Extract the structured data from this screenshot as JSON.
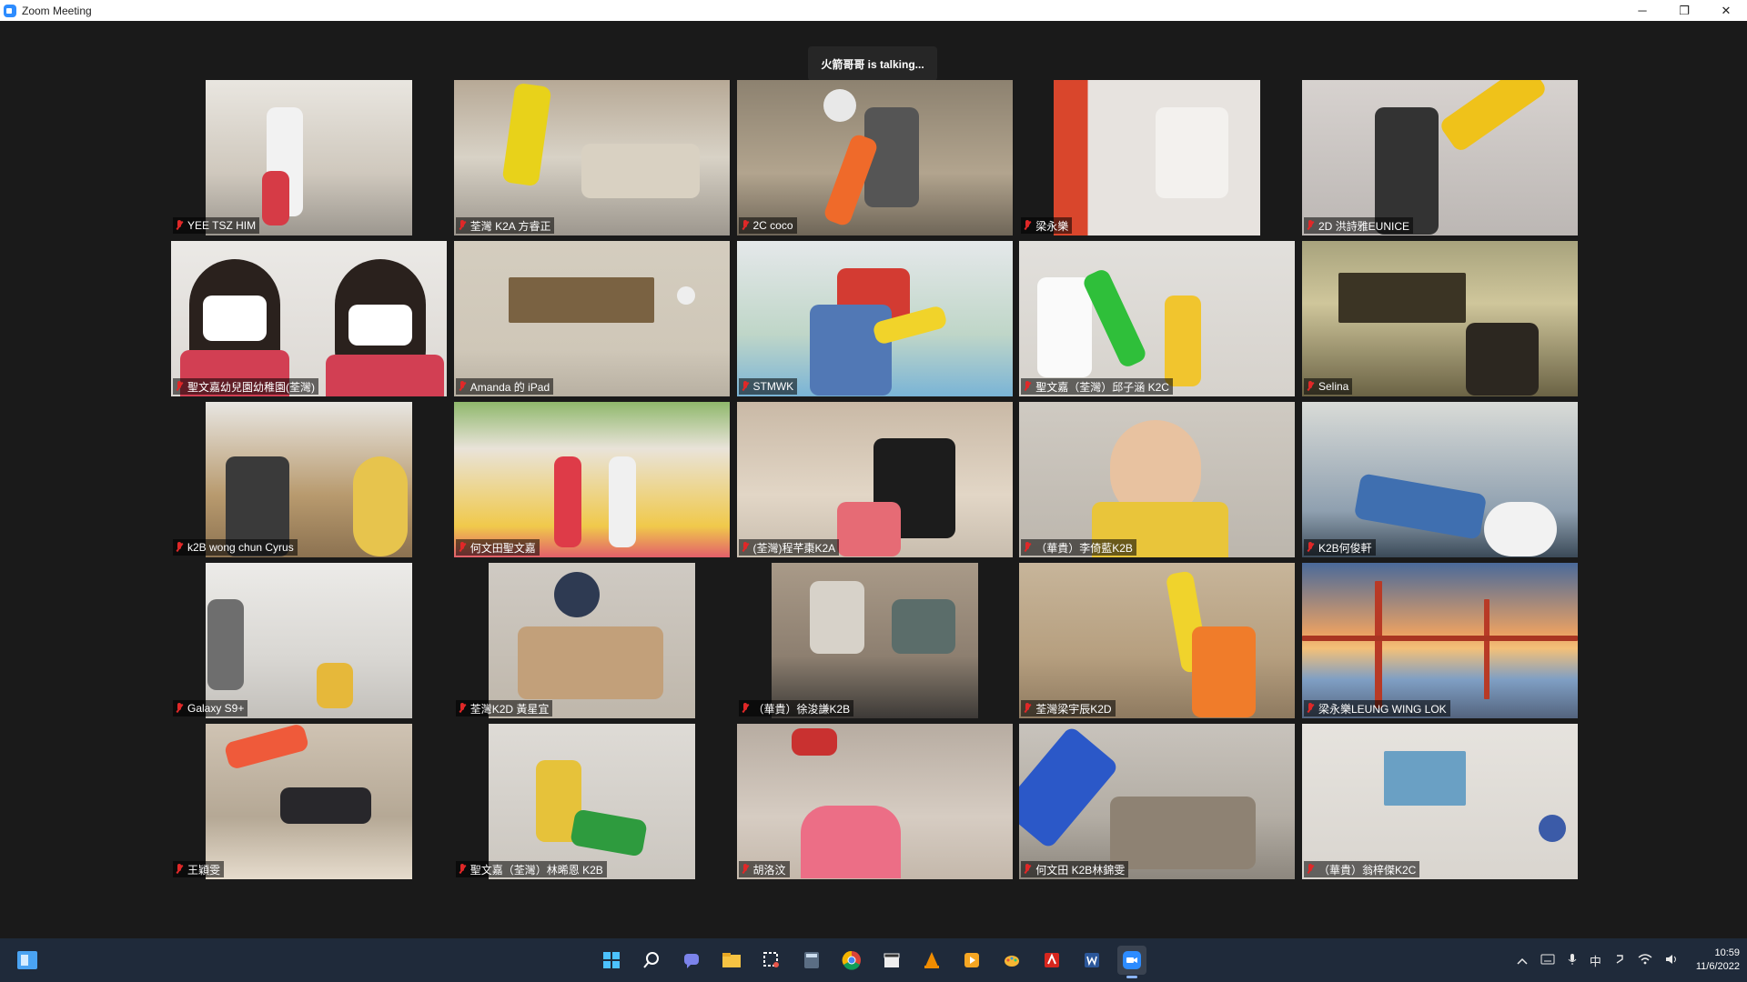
{
  "window": {
    "title": "Zoom Meeting",
    "minimize": "─",
    "restore": "❐",
    "close": "✕"
  },
  "meeting": {
    "speaking_text": "火箭哥哥 is  talking..."
  },
  "participants": [
    {
      "name": "YEE TSZ HIM"
    },
    {
      "name": "荃灣 K2A 方睿正"
    },
    {
      "name": "2C coco"
    },
    {
      "name": "梁永樂"
    },
    {
      "name": "2D 洪詩雅EUNICE"
    },
    {
      "name": "聖文嘉幼兒園幼稚園(荃灣)"
    },
    {
      "name": "Amanda 的 iPad"
    },
    {
      "name": "STMWK"
    },
    {
      "name": "聖文嘉（荃灣）邱子涵 K2C"
    },
    {
      "name": "Selina"
    },
    {
      "name": "k2B wong chun Cyrus"
    },
    {
      "name": "何文田聖文嘉"
    },
    {
      "name": "(荃灣)程芊棗K2A"
    },
    {
      "name": "（華貴）李倚藍K2B"
    },
    {
      "name": "K2B何俊軒"
    },
    {
      "name": "Galaxy S9+"
    },
    {
      "name": "荃灣K2D 黃星宜"
    },
    {
      "name": "（華貴）徐浚謙K2B"
    },
    {
      "name": "荃灣梁宇辰K2D"
    },
    {
      "name": "梁永樂LEUNG WING LOK"
    },
    {
      "name": "王穎雯"
    },
    {
      "name": "聖文嘉（荃灣）林晞恩 K2B"
    },
    {
      "name": "胡洛汶"
    },
    {
      "name": "何文田 K2B林錦雯"
    },
    {
      "name": "（華貴）翁梓傑K2C"
    }
  ],
  "taskbar": {
    "icons": [
      "start-icon",
      "search-icon",
      "chat-icon",
      "file-explorer-icon",
      "snipping-tool-icon",
      "calculator-icon",
      "chrome-icon",
      "clapperboard-icon",
      "vlc-icon",
      "media-player-icon",
      "paint-icon",
      "acrobat-icon",
      "word-icon",
      "zoom-icon"
    ],
    "tray": {
      "ime": "中",
      "time": "10:59",
      "date": "11/6/2022"
    }
  }
}
